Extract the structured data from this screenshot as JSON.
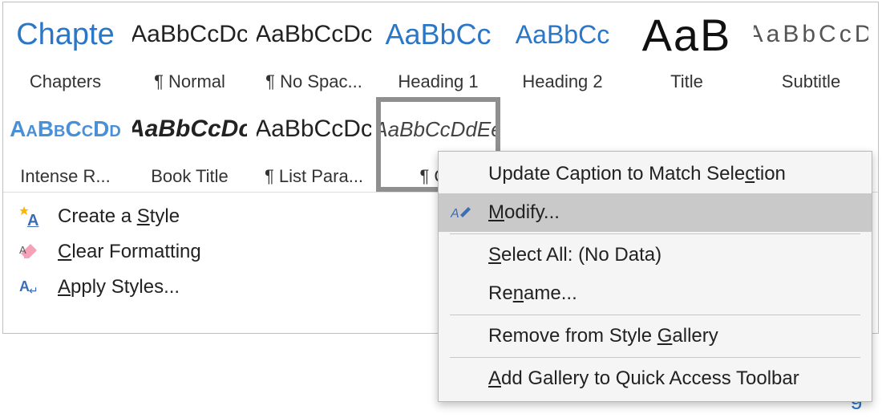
{
  "styles_row1": [
    {
      "preview": "Chapte",
      "label": "Chapters",
      "cls": "preview-chapters"
    },
    {
      "preview": "AaBbCcDc",
      "label": "¶ Normal",
      "cls": "preview-normal"
    },
    {
      "preview": "AaBbCcDc",
      "label": "¶ No Spac...",
      "cls": "preview-nospace"
    },
    {
      "preview": "AaBbCc",
      "label": "Heading 1",
      "cls": "preview-h1"
    },
    {
      "preview": "AaBbCc",
      "label": "Heading 2",
      "cls": "preview-h2"
    },
    {
      "preview": "AaB",
      "label": "Title",
      "cls": "preview-title"
    },
    {
      "preview": "AaBbCcD",
      "label": "Subtitle",
      "cls": "preview-subtitle"
    }
  ],
  "styles_row2": [
    {
      "preview": "AaBbCcDd",
      "label": "Intense R...",
      "cls": "preview-intense"
    },
    {
      "preview": "AaBbCcDc",
      "label": "Book Title",
      "cls": "preview-book"
    },
    {
      "preview": "AaBbCcDc",
      "label": "¶ List Para...",
      "cls": "preview-listpara"
    },
    {
      "preview": "AaBbCcDdEe",
      "label": "¶ Ca",
      "cls": "preview-caption",
      "selected": true
    }
  ],
  "actions": {
    "create": {
      "pre": "Create a ",
      "hot": "S",
      "post": "tyle"
    },
    "clear": {
      "pre": "",
      "hot": "C",
      "post": "lear Formatting"
    },
    "apply": {
      "pre": "",
      "hot": "A",
      "post": "pply Styles..."
    }
  },
  "context_menu": {
    "update": {
      "pre": "Update Caption to Match Sele",
      "hot": "c",
      "post": "tion"
    },
    "modify": {
      "pre": "",
      "hot": "M",
      "post": "odify..."
    },
    "select": {
      "pre": "",
      "hot": "S",
      "post": "elect All: (No Data)"
    },
    "rename": {
      "pre": "Re",
      "hot": "n",
      "post": "ame..."
    },
    "remove": {
      "pre": "Remove from Style ",
      "hot": "G",
      "post": "allery"
    },
    "addqat": {
      "pre": "",
      "hot": "A",
      "post": "dd Gallery to Quick Access Toolbar"
    }
  },
  "doc_fragment": "g"
}
